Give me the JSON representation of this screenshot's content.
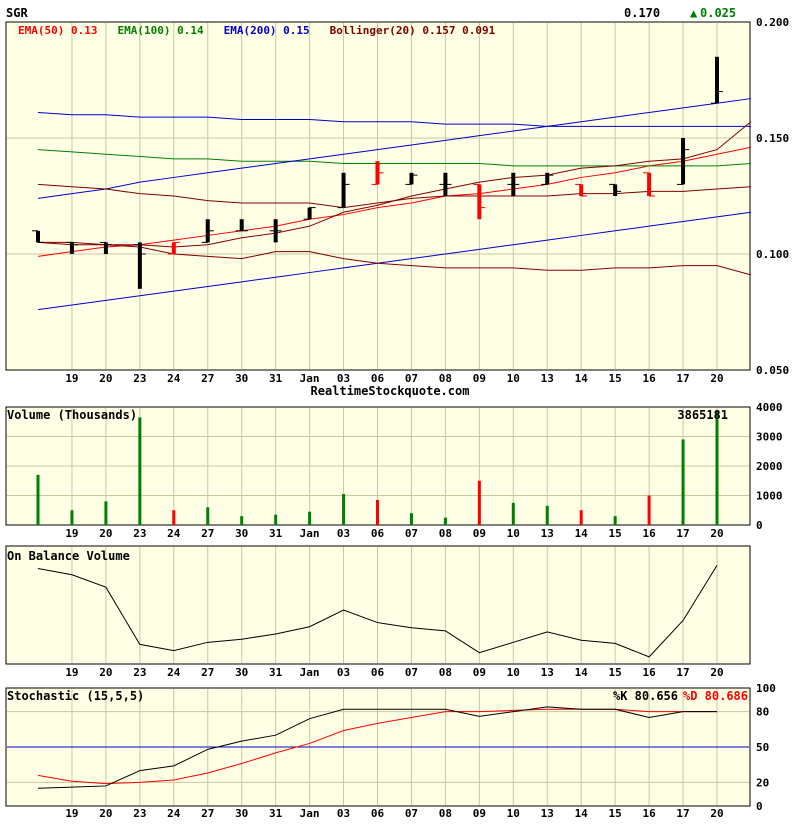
{
  "header": {
    "symbol": "SGR",
    "last": "0.170",
    "change_arrow": "▲",
    "change": "0.025",
    "watermark": "RealtimeStockquote.com"
  },
  "colors": {
    "frame_bg": "#ffffe6",
    "grid": "#c8c8a0",
    "up": "#000000",
    "down": "#ff0000",
    "ema50": "#ff0000",
    "ema100": "#008000",
    "ema200": "#0000cc",
    "bollinger": "#800000",
    "trend": "#0000cc",
    "vol_up": "#008000",
    "vol_down": "#ff0000",
    "stoch_k": "#000000",
    "stoch_d": "#ff0000",
    "stoch_mid": "#0000cc"
  },
  "x_labels": [
    "19",
    "20",
    "23",
    "24",
    "27",
    "30",
    "31",
    "Jan",
    "03",
    "06",
    "07",
    "08",
    "09",
    "10",
    "13",
    "14",
    "15",
    "16",
    "17",
    "20"
  ],
  "chart_data": [
    {
      "id": "price",
      "type": "ohlc",
      "legend": [
        {
          "label": "EMA(50) 0.13",
          "color": "#ff0000"
        },
        {
          "label": "EMA(100) 0.14",
          "color": "#008000"
        },
        {
          "label": "EMA(200) 0.15",
          "color": "#0000cc"
        },
        {
          "label": "Bollinger(20) 0.157 0.091",
          "color": "#800000"
        }
      ],
      "ylim": [
        0.05,
        0.2
      ],
      "yticks": [
        "0.200",
        "0.150",
        "0.100",
        "0.050"
      ],
      "ytick_values": [
        0.2,
        0.15,
        0.1,
        0.05
      ],
      "ohlc": [
        {
          "o": 0.11,
          "h": 0.11,
          "l": 0.105,
          "c": 0.105,
          "dir": "up"
        },
        {
          "o": 0.105,
          "h": 0.105,
          "l": 0.1,
          "c": 0.104,
          "dir": "up"
        },
        {
          "o": 0.105,
          "h": 0.105,
          "l": 0.1,
          "c": 0.104,
          "dir": "up"
        },
        {
          "o": 0.104,
          "h": 0.105,
          "l": 0.085,
          "c": 0.1,
          "dir": "up"
        },
        {
          "o": 0.1,
          "h": 0.105,
          "l": 0.1,
          "c": 0.105,
          "dir": "down"
        },
        {
          "o": 0.105,
          "h": 0.115,
          "l": 0.105,
          "c": 0.11,
          "dir": "up"
        },
        {
          "o": 0.11,
          "h": 0.115,
          "l": 0.11,
          "c": 0.11,
          "dir": "up"
        },
        {
          "o": 0.11,
          "h": 0.115,
          "l": 0.105,
          "c": 0.11,
          "dir": "up"
        },
        {
          "o": 0.115,
          "h": 0.12,
          "l": 0.115,
          "c": 0.12,
          "dir": "up"
        },
        {
          "o": 0.12,
          "h": 0.135,
          "l": 0.12,
          "c": 0.13,
          "dir": "up"
        },
        {
          "o": 0.13,
          "h": 0.14,
          "l": 0.13,
          "c": 0.135,
          "dir": "down"
        },
        {
          "o": 0.13,
          "h": 0.135,
          "l": 0.13,
          "c": 0.134,
          "dir": "up"
        },
        {
          "o": 0.13,
          "h": 0.135,
          "l": 0.125,
          "c": 0.13,
          "dir": "up"
        },
        {
          "o": 0.13,
          "h": 0.13,
          "l": 0.115,
          "c": 0.12,
          "dir": "down"
        },
        {
          "o": 0.13,
          "h": 0.135,
          "l": 0.125,
          "c": 0.13,
          "dir": "up"
        },
        {
          "o": 0.13,
          "h": 0.135,
          "l": 0.13,
          "c": 0.134,
          "dir": "up"
        },
        {
          "o": 0.13,
          "h": 0.13,
          "l": 0.125,
          "c": 0.125,
          "dir": "down"
        },
        {
          "o": 0.13,
          "h": 0.13,
          "l": 0.125,
          "c": 0.127,
          "dir": "up"
        },
        {
          "o": 0.135,
          "h": 0.135,
          "l": 0.125,
          "c": 0.125,
          "dir": "down"
        },
        {
          "o": 0.13,
          "h": 0.15,
          "l": 0.13,
          "c": 0.145,
          "dir": "up"
        },
        {
          "o": 0.165,
          "h": 0.185,
          "l": 0.165,
          "c": 0.17,
          "dir": "up"
        }
      ],
      "lines": [
        {
          "name": "ema50",
          "color": "#ff0000",
          "values": [
            0.099,
            0.101,
            0.103,
            0.104,
            0.106,
            0.108,
            0.11,
            0.112,
            0.115,
            0.117,
            0.12,
            0.122,
            0.125,
            0.126,
            0.128,
            0.13,
            0.133,
            0.135,
            0.138,
            0.14,
            0.143,
            0.146
          ]
        },
        {
          "name": "ema100",
          "color": "#008000",
          "values": [
            0.145,
            0.144,
            0.143,
            0.142,
            0.141,
            0.141,
            0.14,
            0.14,
            0.14,
            0.139,
            0.139,
            0.139,
            0.139,
            0.139,
            0.138,
            0.138,
            0.138,
            0.138,
            0.138,
            0.138,
            0.138,
            0.139
          ]
        },
        {
          "name": "ema200",
          "color": "#0000cc",
          "values": [
            0.161,
            0.16,
            0.16,
            0.159,
            0.159,
            0.159,
            0.158,
            0.158,
            0.158,
            0.157,
            0.157,
            0.157,
            0.156,
            0.156,
            0.156,
            0.155,
            0.155,
            0.155,
            0.155,
            0.155,
            0.155,
            0.155
          ]
        },
        {
          "name": "trend-upper",
          "color": "#0000cc",
          "values": [
            0.124,
            0.126,
            0.128,
            0.131,
            0.133,
            0.135,
            0.137,
            0.139,
            0.141,
            0.143,
            0.145,
            0.147,
            0.149,
            0.151,
            0.153,
            0.155,
            0.157,
            0.159,
            0.161,
            0.163,
            0.165,
            0.167
          ]
        },
        {
          "name": "trend-lower",
          "color": "#0000cc",
          "values": [
            0.076,
            0.078,
            0.08,
            0.082,
            0.084,
            0.086,
            0.088,
            0.09,
            0.092,
            0.094,
            0.096,
            0.098,
            0.1,
            0.102,
            0.104,
            0.106,
            0.108,
            0.11,
            0.112,
            0.114,
            0.116,
            0.118
          ]
        },
        {
          "name": "bollinger-upper",
          "color": "#800000",
          "values": [
            0.13,
            0.129,
            0.128,
            0.126,
            0.125,
            0.123,
            0.122,
            0.122,
            0.122,
            0.12,
            0.122,
            0.124,
            0.125,
            0.125,
            0.125,
            0.125,
            0.126,
            0.126,
            0.127,
            0.127,
            0.128,
            0.129
          ]
        },
        {
          "name": "bollinger-middle",
          "color": "#800000",
          "values": [
            0.105,
            0.105,
            0.104,
            0.104,
            0.103,
            0.104,
            0.107,
            0.109,
            0.112,
            0.118,
            0.121,
            0.125,
            0.128,
            0.131,
            0.133,
            0.134,
            0.137,
            0.138,
            0.14,
            0.141,
            0.145,
            0.157
          ]
        },
        {
          "name": "bollinger-lower",
          "color": "#800000",
          "values": [
            0.105,
            0.104,
            0.104,
            0.103,
            0.1,
            0.099,
            0.098,
            0.101,
            0.101,
            0.098,
            0.096,
            0.095,
            0.094,
            0.094,
            0.094,
            0.093,
            0.093,
            0.094,
            0.094,
            0.095,
            0.095,
            0.091
          ]
        }
      ]
    },
    {
      "id": "volume",
      "type": "bar",
      "title": "Volume (Thousands)",
      "last_label": "3865181",
      "ylim": [
        0,
        4000
      ],
      "yticks": [
        "4000",
        "3000",
        "2000",
        "1000",
        "0"
      ],
      "ytick_values": [
        4000,
        3000,
        2000,
        1000,
        0
      ],
      "values": [
        1700,
        500,
        800,
        3650,
        500,
        600,
        300,
        350,
        450,
        1050,
        850,
        400,
        250,
        1500,
        750,
        650,
        500,
        300,
        1000,
        2900,
        3865
      ],
      "dirs": [
        "up",
        "up",
        "up",
        "up",
        "down",
        "up",
        "up",
        "up",
        "up",
        "up",
        "down",
        "up",
        "up",
        "down",
        "up",
        "up",
        "down",
        "up",
        "down",
        "up",
        "up"
      ]
    },
    {
      "id": "obv",
      "type": "line",
      "title": "On Balance Volume",
      "ylim": [
        0,
        100
      ],
      "values": [
        88,
        82,
        70,
        15,
        9,
        17,
        20,
        25,
        32,
        48,
        36,
        31,
        28,
        7,
        17,
        27,
        19,
        16,
        3,
        38,
        91
      ]
    },
    {
      "id": "stochastic",
      "type": "line",
      "title": "Stochastic (15,5,5)",
      "k_label": "%K 80.656",
      "d_label": "%D 80.686",
      "ylim": [
        0,
        100
      ],
      "yticks": [
        "100",
        "80",
        "50",
        "20",
        "0"
      ],
      "ytick_values": [
        100,
        80,
        50,
        20,
        0
      ],
      "reference": 50,
      "k_values": [
        15,
        16,
        17,
        30,
        34,
        48,
        55,
        60,
        74,
        82,
        82,
        82,
        82,
        76,
        80,
        84,
        82,
        82,
        75,
        80,
        80
      ],
      "d_values": [
        26,
        21,
        19,
        20,
        22,
        28,
        36,
        45,
        53,
        64,
        70,
        75,
        80,
        80,
        81,
        82,
        82,
        82,
        80,
        80,
        80
      ]
    }
  ]
}
